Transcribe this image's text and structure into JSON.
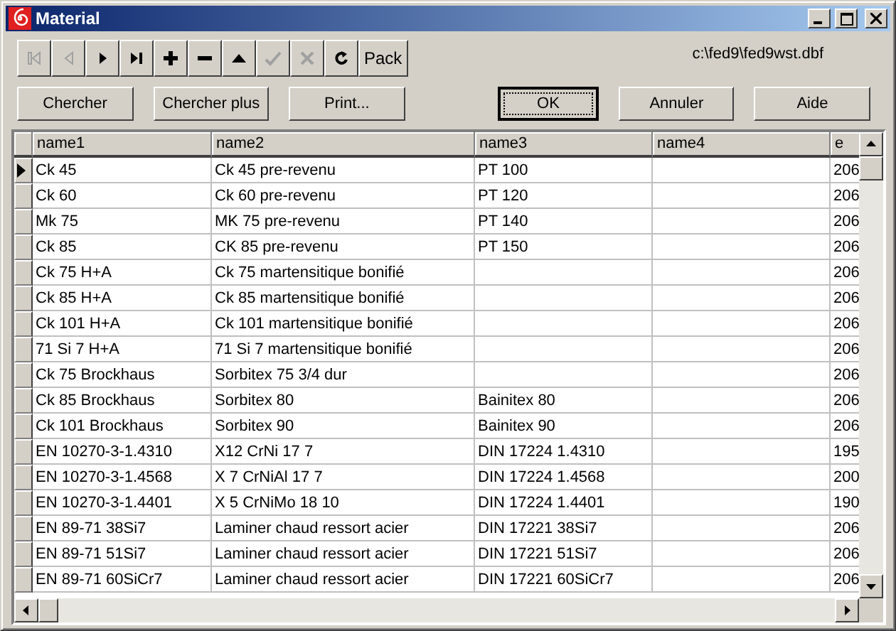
{
  "window": {
    "title": "Material"
  },
  "navigator": [
    {
      "kind": "first",
      "disabled": true
    },
    {
      "kind": "prior",
      "disabled": true
    },
    {
      "kind": "next",
      "disabled": false
    },
    {
      "kind": "last",
      "disabled": false
    },
    {
      "kind": "insert",
      "disabled": false
    },
    {
      "kind": "delete",
      "disabled": false
    },
    {
      "kind": "edit",
      "disabled": false
    },
    {
      "kind": "post",
      "disabled": true
    },
    {
      "kind": "cancel",
      "disabled": true
    },
    {
      "kind": "refresh",
      "disabled": false
    },
    {
      "kind": "text",
      "label": "Pack",
      "disabled": false
    }
  ],
  "file_path": "c:\\fed9\\fed9wst.dbf",
  "left_buttons": [
    {
      "label": "Chercher",
      "default": false
    },
    {
      "label": "Chercher plus",
      "default": false
    },
    {
      "label": "Print...",
      "default": false
    }
  ],
  "right_buttons": [
    {
      "label": "OK",
      "default": true
    },
    {
      "label": "Annuler",
      "default": false
    },
    {
      "label": "Aide",
      "default": false
    }
  ],
  "table": {
    "columns": [
      "name1",
      "name2",
      "name3",
      "name4",
      "e"
    ],
    "rows": [
      {
        "selected": true,
        "cells": [
          "Ck 45",
          "Ck 45 pre-revenu",
          "PT 100",
          "",
          "206"
        ]
      },
      {
        "selected": false,
        "cells": [
          "Ck 60",
          "Ck 60 pre-revenu",
          "PT 120",
          "",
          "206"
        ]
      },
      {
        "selected": false,
        "cells": [
          "Mk 75",
          "MK 75 pre-revenu",
          "PT 140",
          "",
          "206"
        ]
      },
      {
        "selected": false,
        "cells": [
          "Ck 85",
          "CK 85 pre-revenu",
          "PT 150",
          "",
          "206"
        ]
      },
      {
        "selected": false,
        "cells": [
          "Ck 75 H+A",
          "Ck 75 martensitique bonifié",
          "",
          "",
          "206"
        ]
      },
      {
        "selected": false,
        "cells": [
          "Ck 85 H+A",
          "Ck 85 martensitique bonifié",
          "",
          "",
          "206"
        ]
      },
      {
        "selected": false,
        "cells": [
          "Ck 101 H+A",
          "Ck 101 martensitique bonifié",
          "",
          "",
          "206"
        ]
      },
      {
        "selected": false,
        "cells": [
          "71 Si 7 H+A",
          "71 Si 7 martensitique bonifié",
          "",
          "",
          "206"
        ]
      },
      {
        "selected": false,
        "cells": [
          "Ck 75 Brockhaus",
          "Sorbitex 75  3/4 dur",
          "",
          "",
          "206"
        ]
      },
      {
        "selected": false,
        "cells": [
          "Ck 85 Brockhaus",
          "Sorbitex 80",
          "Bainitex 80",
          "",
          "206"
        ]
      },
      {
        "selected": false,
        "cells": [
          "Ck 101 Brockhaus",
          "Sorbitex 90",
          "Bainitex 90",
          "",
          "206"
        ]
      },
      {
        "selected": false,
        "cells": [
          "EN 10270-3-1.4310",
          "X12 CrNi 17 7",
          "DIN 17224 1.4310",
          "",
          "195"
        ]
      },
      {
        "selected": false,
        "cells": [
          "EN 10270-3-1.4568",
          "X 7 CrNiAl 17 7",
          "DIN 17224 1.4568",
          "",
          "200"
        ]
      },
      {
        "selected": false,
        "cells": [
          "EN 10270-3-1.4401",
          "X 5 CrNiMo 18 10",
          "DIN 17224 1.4401",
          "",
          "190"
        ]
      },
      {
        "selected": false,
        "cells": [
          "EN 89-71 38Si7",
          "Laminer chaud ressort acier",
          "DIN 17221 38Si7",
          "",
          "206"
        ]
      },
      {
        "selected": false,
        "cells": [
          "EN 89-71 51Si7",
          "Laminer chaud ressort acier",
          "DIN 17221 51Si7",
          "",
          "206"
        ]
      },
      {
        "selected": false,
        "cells": [
          "EN 89-71 60SiCr7",
          "Laminer chaud ressort  acier",
          "DIN 17221 60SiCr7",
          "",
          "206"
        ]
      }
    ]
  }
}
